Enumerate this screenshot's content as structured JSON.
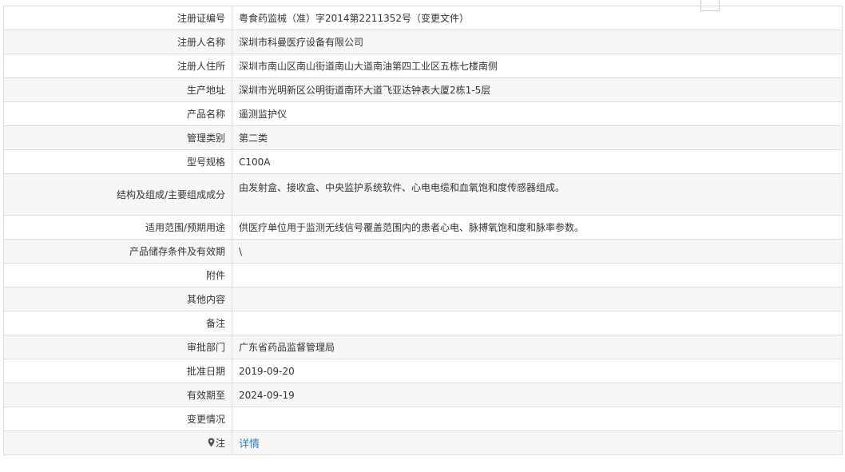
{
  "rows": [
    {
      "label": "注册证编号",
      "value": "粤食药监械（准）字2014第2211352号（变更文件）"
    },
    {
      "label": "注册人名称",
      "value": "深圳市科曼医疗设备有限公司"
    },
    {
      "label": "注册人住所",
      "value": "深圳市南山区南山街道南山大道南油第四工业区五栋七楼南侧"
    },
    {
      "label": "生产地址",
      "value": "深圳市光明新区公明街道南环大道飞亚达钟表大厦2栋1-5层"
    },
    {
      "label": "产品名称",
      "value": "遥测监护仪"
    },
    {
      "label": "管理类别",
      "value": "第二类"
    },
    {
      "label": "型号规格",
      "value": "C100A"
    },
    {
      "label": "结构及组成/主要组成成分",
      "value": "由发射盒、接收盒、中央监护系统软件、心电电缆和血氧饱和度传感器组成。"
    },
    {
      "label": "适用范围/预期用途",
      "value": "供医疗单位用于监测无线信号覆盖范围内的患者心电、脉搏氧饱和度和脉率参数。"
    },
    {
      "label": "产品储存条件及有效期",
      "value": "\\"
    },
    {
      "label": "附件",
      "value": ""
    },
    {
      "label": "其他内容",
      "value": ""
    },
    {
      "label": "备注",
      "value": ""
    },
    {
      "label": "审批部门",
      "value": "广东省药品监督管理局"
    },
    {
      "label": "批准日期",
      "value": "2019-09-20"
    },
    {
      "label": "有效期至",
      "value": "2024-09-19"
    },
    {
      "label": "变更情况",
      "value": ""
    }
  ],
  "note": {
    "label": "注",
    "icon": "pin-icon",
    "link_text": "详情"
  }
}
